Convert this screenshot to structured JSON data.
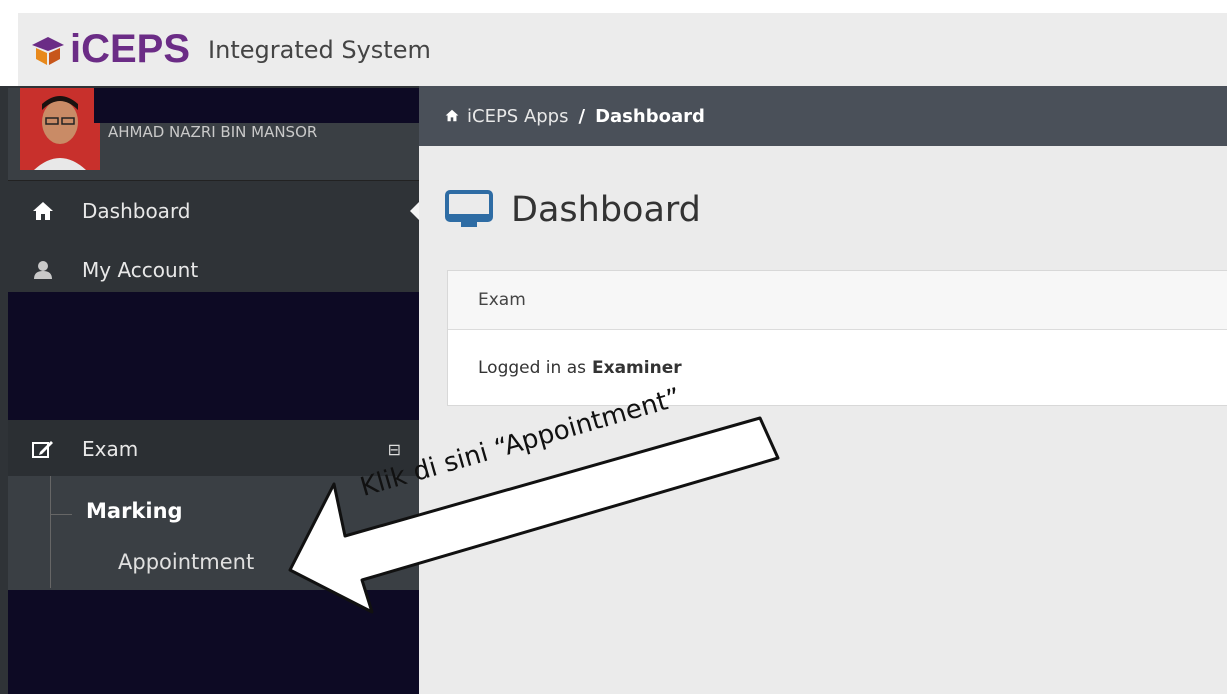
{
  "header": {
    "brand": "iCEPS",
    "subtitle": "Integrated System"
  },
  "user": {
    "name": "AHMAD NAZRI BIN MANSOR"
  },
  "sidebar": {
    "items": [
      {
        "label": "Dashboard",
        "icon": "home-icon",
        "active": true
      },
      {
        "label": "My Account",
        "icon": "user-icon"
      },
      {
        "label": "Exam",
        "icon": "edit-icon",
        "expanded_indicator": "⊟"
      }
    ],
    "submenu": {
      "group": "Marking",
      "item": "Appointment"
    }
  },
  "breadcrumb": {
    "root": "iCEPS Apps",
    "separator": "/",
    "current": "Dashboard"
  },
  "page": {
    "title": "Dashboard"
  },
  "panel": {
    "heading": "Exam",
    "body_prefix": "Logged in as",
    "role": "Examiner"
  },
  "annotation": {
    "text": "Klik di sini “Appointment”"
  },
  "colors": {
    "brand": "#6b2c86",
    "sidebar": "#2f3337",
    "breadcrumb_bar": "#4a5059",
    "monitor_icon": "#2e6ca4"
  }
}
